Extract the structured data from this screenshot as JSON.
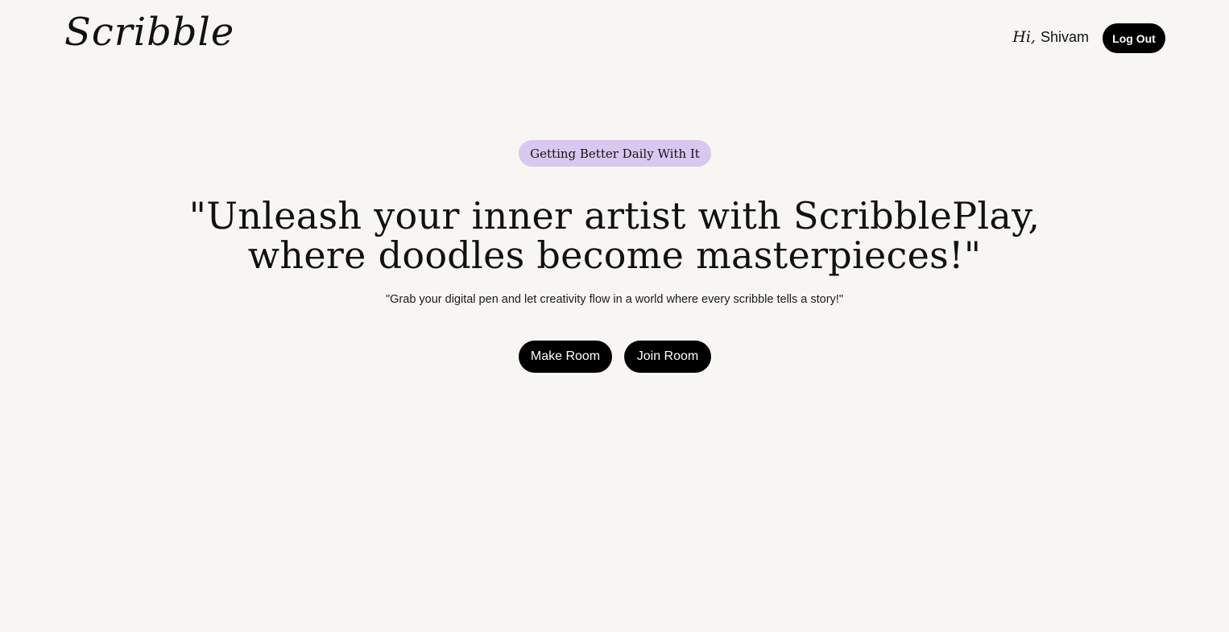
{
  "header": {
    "logo": "Scribble",
    "greeting_prefix": "Hi,",
    "user_name": "Shivam",
    "logout_label": "Log Out"
  },
  "hero": {
    "badge": "Getting Better Daily With It",
    "headline_line1": "\"Unleash your inner artist with ScribblePlay,",
    "headline_line2": "where doodles become masterpieces!\"",
    "subheadline": "\"Grab your digital pen and let creativity flow in a world where every scribble tells a story!\"",
    "make_room_label": "Make Room",
    "join_room_label": "Join Room"
  },
  "colors": {
    "background": "#f7f6f3",
    "badge": "#d9c7ef",
    "button": "#000000",
    "button_text": "#ffffff"
  }
}
